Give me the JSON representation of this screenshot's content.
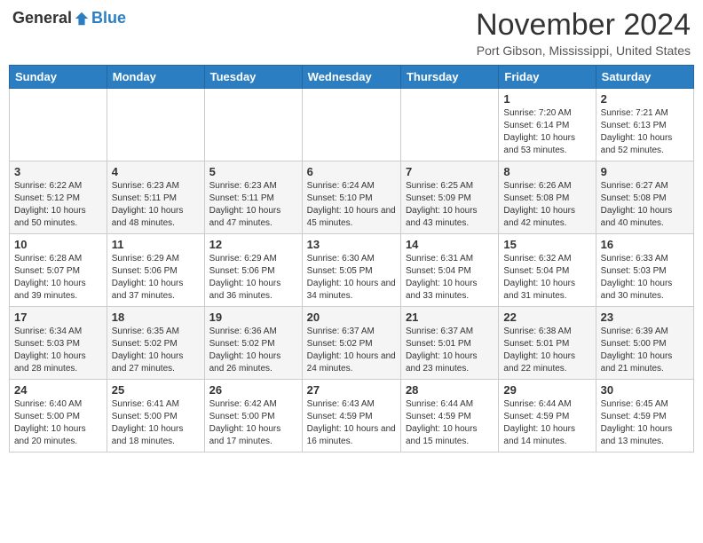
{
  "header": {
    "logo_general": "General",
    "logo_blue": "Blue",
    "month_title": "November 2024",
    "location": "Port Gibson, Mississippi, United States"
  },
  "weekdays": [
    "Sunday",
    "Monday",
    "Tuesday",
    "Wednesday",
    "Thursday",
    "Friday",
    "Saturday"
  ],
  "weeks": [
    [
      {
        "day": "",
        "info": ""
      },
      {
        "day": "",
        "info": ""
      },
      {
        "day": "",
        "info": ""
      },
      {
        "day": "",
        "info": ""
      },
      {
        "day": "",
        "info": ""
      },
      {
        "day": "1",
        "info": "Sunrise: 7:20 AM\nSunset: 6:14 PM\nDaylight: 10 hours and 53 minutes."
      },
      {
        "day": "2",
        "info": "Sunrise: 7:21 AM\nSunset: 6:13 PM\nDaylight: 10 hours and 52 minutes."
      }
    ],
    [
      {
        "day": "3",
        "info": "Sunrise: 6:22 AM\nSunset: 5:12 PM\nDaylight: 10 hours and 50 minutes."
      },
      {
        "day": "4",
        "info": "Sunrise: 6:23 AM\nSunset: 5:11 PM\nDaylight: 10 hours and 48 minutes."
      },
      {
        "day": "5",
        "info": "Sunrise: 6:23 AM\nSunset: 5:11 PM\nDaylight: 10 hours and 47 minutes."
      },
      {
        "day": "6",
        "info": "Sunrise: 6:24 AM\nSunset: 5:10 PM\nDaylight: 10 hours and 45 minutes."
      },
      {
        "day": "7",
        "info": "Sunrise: 6:25 AM\nSunset: 5:09 PM\nDaylight: 10 hours and 43 minutes."
      },
      {
        "day": "8",
        "info": "Sunrise: 6:26 AM\nSunset: 5:08 PM\nDaylight: 10 hours and 42 minutes."
      },
      {
        "day": "9",
        "info": "Sunrise: 6:27 AM\nSunset: 5:08 PM\nDaylight: 10 hours and 40 minutes."
      }
    ],
    [
      {
        "day": "10",
        "info": "Sunrise: 6:28 AM\nSunset: 5:07 PM\nDaylight: 10 hours and 39 minutes."
      },
      {
        "day": "11",
        "info": "Sunrise: 6:29 AM\nSunset: 5:06 PM\nDaylight: 10 hours and 37 minutes."
      },
      {
        "day": "12",
        "info": "Sunrise: 6:29 AM\nSunset: 5:06 PM\nDaylight: 10 hours and 36 minutes."
      },
      {
        "day": "13",
        "info": "Sunrise: 6:30 AM\nSunset: 5:05 PM\nDaylight: 10 hours and 34 minutes."
      },
      {
        "day": "14",
        "info": "Sunrise: 6:31 AM\nSunset: 5:04 PM\nDaylight: 10 hours and 33 minutes."
      },
      {
        "day": "15",
        "info": "Sunrise: 6:32 AM\nSunset: 5:04 PM\nDaylight: 10 hours and 31 minutes."
      },
      {
        "day": "16",
        "info": "Sunrise: 6:33 AM\nSunset: 5:03 PM\nDaylight: 10 hours and 30 minutes."
      }
    ],
    [
      {
        "day": "17",
        "info": "Sunrise: 6:34 AM\nSunset: 5:03 PM\nDaylight: 10 hours and 28 minutes."
      },
      {
        "day": "18",
        "info": "Sunrise: 6:35 AM\nSunset: 5:02 PM\nDaylight: 10 hours and 27 minutes."
      },
      {
        "day": "19",
        "info": "Sunrise: 6:36 AM\nSunset: 5:02 PM\nDaylight: 10 hours and 26 minutes."
      },
      {
        "day": "20",
        "info": "Sunrise: 6:37 AM\nSunset: 5:02 PM\nDaylight: 10 hours and 24 minutes."
      },
      {
        "day": "21",
        "info": "Sunrise: 6:37 AM\nSunset: 5:01 PM\nDaylight: 10 hours and 23 minutes."
      },
      {
        "day": "22",
        "info": "Sunrise: 6:38 AM\nSunset: 5:01 PM\nDaylight: 10 hours and 22 minutes."
      },
      {
        "day": "23",
        "info": "Sunrise: 6:39 AM\nSunset: 5:00 PM\nDaylight: 10 hours and 21 minutes."
      }
    ],
    [
      {
        "day": "24",
        "info": "Sunrise: 6:40 AM\nSunset: 5:00 PM\nDaylight: 10 hours and 20 minutes."
      },
      {
        "day": "25",
        "info": "Sunrise: 6:41 AM\nSunset: 5:00 PM\nDaylight: 10 hours and 18 minutes."
      },
      {
        "day": "26",
        "info": "Sunrise: 6:42 AM\nSunset: 5:00 PM\nDaylight: 10 hours and 17 minutes."
      },
      {
        "day": "27",
        "info": "Sunrise: 6:43 AM\nSunset: 4:59 PM\nDaylight: 10 hours and 16 minutes."
      },
      {
        "day": "28",
        "info": "Sunrise: 6:44 AM\nSunset: 4:59 PM\nDaylight: 10 hours and 15 minutes."
      },
      {
        "day": "29",
        "info": "Sunrise: 6:44 AM\nSunset: 4:59 PM\nDaylight: 10 hours and 14 minutes."
      },
      {
        "day": "30",
        "info": "Sunrise: 6:45 AM\nSunset: 4:59 PM\nDaylight: 10 hours and 13 minutes."
      }
    ]
  ]
}
